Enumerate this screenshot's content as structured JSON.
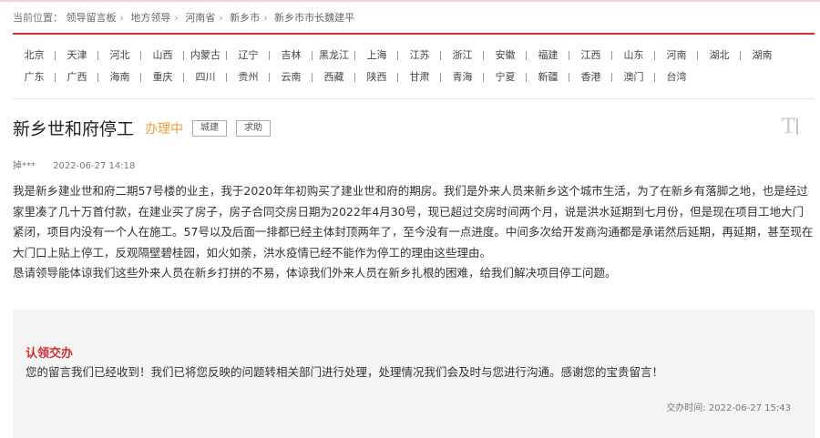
{
  "breadcrumb": {
    "label": "当前位置：",
    "items": [
      "领导留言板",
      "地方领导",
      "河南省",
      "新乡市",
      "新乡市市长魏建平"
    ],
    "separator": "›"
  },
  "regions": {
    "row1": [
      "北京",
      "天津",
      "河北",
      "山西",
      "内蒙古",
      "辽宁",
      "吉林",
      "黑龙江",
      "上海",
      "江苏",
      "浙江",
      "安徽",
      "福建",
      "江西",
      "山东",
      "河南",
      "湖北",
      "湖南"
    ],
    "row2": [
      "广东",
      "广西",
      "海南",
      "重庆",
      "四川",
      "贵州",
      "云南",
      "西藏",
      "陕西",
      "甘肃",
      "青海",
      "宁夏",
      "新疆",
      "香港",
      "澳门",
      "台湾"
    ]
  },
  "post": {
    "title": "新乡世和府停工",
    "status": "办理中",
    "tags": [
      "城建",
      "求助"
    ],
    "author": "掉***",
    "time": "2022-06-27 14:18",
    "paragraphs": [
      "我是新乡建业世和府二期57号楼的业主，我于2020年年初购买了建业世和府的期房。我们是外来人员来新乡这个城市生活，为了在新乡有落脚之地，也是经过家里凑了几十万首付款，在建业买了房子，房子合同交房日期为2022年4月30号，现已超过交房时间两个月，说是洪水延期到七月份，但是现在项目工地大门紧闭，项目内没有一个人在施工。57号以及后面一排都已经主体封顶两年了，至今没有一点进度。中间多次给开发商沟通都是承诺然后延期，再延期，甚至现在大门口上贴上停工，反观隔壁碧桂园，如火如荼，洪水疫情已经不能作为停工的理由这些理由。",
      "恳请领导能体谅我们这些外来人员在新乡打拼的不易，体谅我们外来人员在新乡扎根的困难，给我们解决项目停工问题。"
    ]
  },
  "reply": {
    "title": "认领交办",
    "body": "您的留言我们已经收到！我们已将您反映的问题转相关部门进行处理，处理情况我们会及时与您进行沟通。感谢您的宝贵留言！",
    "time_label": "交办时间:",
    "time": "2022-06-27 15:43"
  },
  "colors": {
    "accent_red": "#d32f2f",
    "status_orange": "#f19a35"
  },
  "icons": {
    "text_size": "text-size-icon",
    "text_size_glyph": "T"
  }
}
